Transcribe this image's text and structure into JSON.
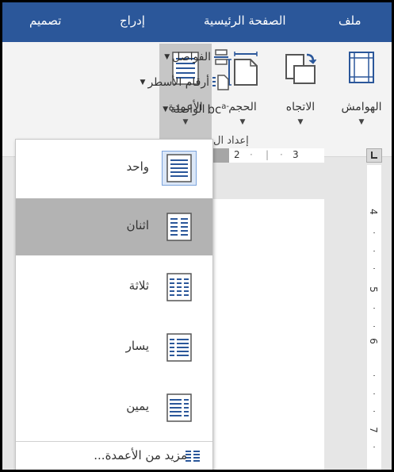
{
  "tabs": {
    "file": "ملف",
    "home": "الصفحة الرئيسية",
    "insert": "إدراج",
    "design": "تصميم"
  },
  "ribbon": {
    "margins": "الهوامش",
    "orientation": "الاتجاه",
    "size": "الحجم",
    "columns": "الأعمدة",
    "breaks": "الفواصل",
    "line_numbers": "أرقام الأسطر",
    "hyphenation": "الواصلة",
    "group_label": "إعداد ال"
  },
  "ruler": {
    "h_labels": [
      "2",
      "3"
    ],
    "v_labels": [
      "4",
      "5",
      "6",
      "7"
    ]
  },
  "columns_menu": {
    "items": [
      {
        "label": "واحد",
        "columns": 1
      },
      {
        "label": "اثنان",
        "columns": 2
      },
      {
        "label": "ثلاثة",
        "columns": 3
      },
      {
        "label": "يسار",
        "columns": "left"
      },
      {
        "label": "يمين",
        "columns": "right"
      }
    ],
    "more": "مزيد من الأعمدة..."
  },
  "colors": {
    "tab_bar": "#2b579a",
    "icon_blue": "#2b579a",
    "hover": "#b3b3b3",
    "selected_border": "#7ca4dd"
  }
}
